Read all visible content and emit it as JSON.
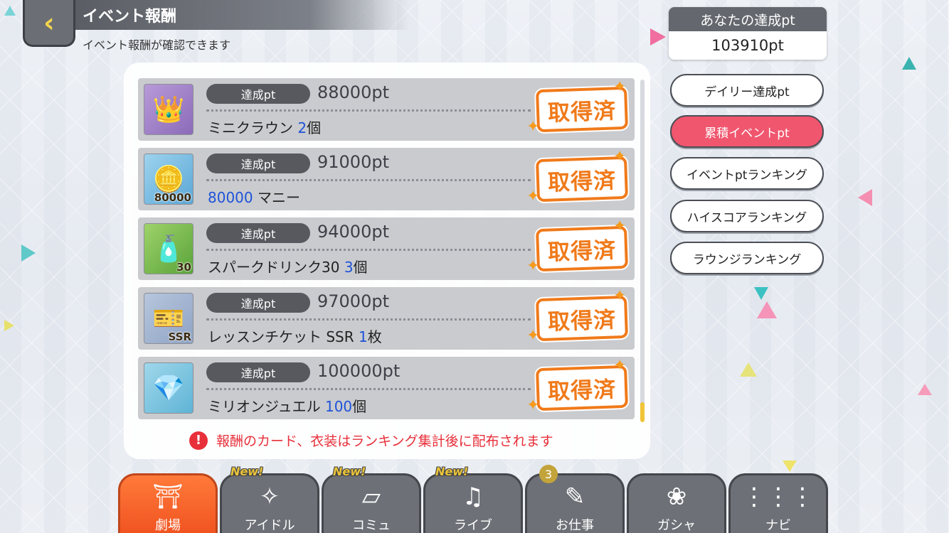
{
  "header": {
    "back_icon": "chevron-left-icon",
    "title": "イベント報酬",
    "subtitle": "イベント報酬が確認できます"
  },
  "achievement": {
    "label": "あなたの達成pt",
    "value": "103910pt"
  },
  "side_menu": [
    {
      "label": "デイリー達成pt",
      "active": false
    },
    {
      "label": "累積イベントpt",
      "active": true
    },
    {
      "label": "イベントptランキング",
      "active": false
    },
    {
      "label": "ハイスコアランキング",
      "active": false
    },
    {
      "label": "ラウンジランキング",
      "active": false
    }
  ],
  "rewards": [
    {
      "pt_label": "達成pt",
      "pt_value": "88000pt",
      "name": "ミニクラウン ",
      "qty": "2",
      "unit": "個",
      "icon": "crown-icon",
      "icon_text": "",
      "status": "取得済"
    },
    {
      "pt_label": "達成pt",
      "pt_value": "91000pt",
      "name": " マニー",
      "qty": "80000",
      "unit": "",
      "icon": "coins-icon",
      "icon_text": "80000",
      "status": "取得済"
    },
    {
      "pt_label": "達成pt",
      "pt_value": "94000pt",
      "name": "スパークドリンク30 ",
      "qty": "3",
      "unit": "個",
      "icon": "drink-icon",
      "icon_text": "30",
      "status": "取得済"
    },
    {
      "pt_label": "達成pt",
      "pt_value": "97000pt",
      "name": "レッスンチケット SSR ",
      "qty": "1",
      "unit": "枚",
      "icon": "ticket-icon",
      "icon_text": "SSR",
      "status": "取得済"
    },
    {
      "pt_label": "達成pt",
      "pt_value": "100000pt",
      "name": "ミリオンジュエル ",
      "qty": "100",
      "unit": "個",
      "icon": "jewel-icon",
      "icon_text": "",
      "status": "取得済"
    }
  ],
  "notice": "報酬のカード、衣装はランキング集計後に配布されます",
  "nav": [
    {
      "label": "劇場",
      "icon": "theater-icon",
      "active": true,
      "badge": ""
    },
    {
      "label": "アイドル",
      "icon": "idol-icon",
      "active": false,
      "badge": "New!"
    },
    {
      "label": "コミュ",
      "icon": "commu-icon",
      "active": false,
      "badge": "New!"
    },
    {
      "label": "ライブ",
      "icon": "live-icon",
      "active": false,
      "badge": "New!"
    },
    {
      "label": "お仕事",
      "icon": "work-icon",
      "active": false,
      "badge": "3"
    },
    {
      "label": "ガシャ",
      "icon": "gacha-icon",
      "active": false,
      "badge": ""
    },
    {
      "label": "ナビ",
      "icon": "navi-icon",
      "active": false,
      "badge": ""
    }
  ],
  "colors": {
    "accent_pink": "#f0566e",
    "stamp_orange": "#f07a1a",
    "qty_blue": "#1f52d8",
    "notice_red": "#e8303a",
    "active_tab": "#f05320"
  }
}
